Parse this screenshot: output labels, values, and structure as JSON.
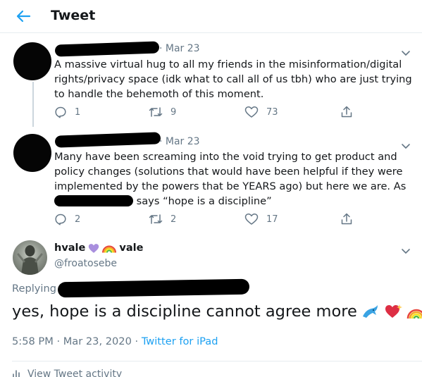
{
  "header": {
    "title": "Tweet",
    "back_icon": "arrow-left-icon",
    "accent": "#1da1f2"
  },
  "thread": [
    {
      "date": "· Mar 23",
      "text": "A massive virtual hug to all my friends in the misinformation/digital rights/privacy space (idk what to call all of us tbh) who are just trying to handle the behemoth of this moment.",
      "replies": "1",
      "retweets": "9",
      "likes": "73"
    },
    {
      "date": "· Mar 23",
      "text_before": "Many have been screaming into the void trying to get product and policy changes (solutions that would have been helpful if they were implemented by the powers that be YEARS ago) but here we are. As",
      "text_after": "says “hope is a discipline”",
      "replies": "2",
      "retweets": "2",
      "likes": "17"
    }
  ],
  "main": {
    "name_prefix": "hvale",
    "name_suffix": "vale",
    "handle": "@froatosebe",
    "replying_label": "Replying to",
    "text": "yes, hope is a discipline cannot agree more",
    "emoji": [
      "dolphin-emoji",
      "sparkling-heart-emoji",
      "rainbow-emoji"
    ],
    "time": "5:58 PM · Mar 23, 2020",
    "separator": " · ",
    "source": "Twitter for iPad",
    "activity_label": "View Tweet activity"
  }
}
